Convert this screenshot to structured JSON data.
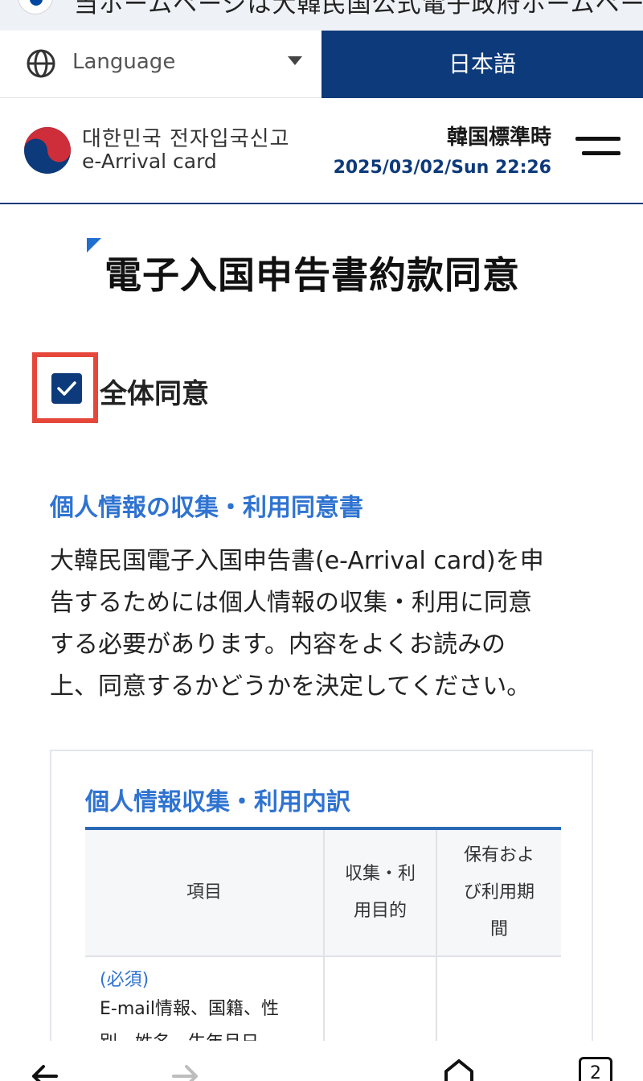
{
  "notice": {
    "text": "当ホームページは大韓民国公式電子政府ホームページです。"
  },
  "language_bar": {
    "label": "Language",
    "selected": "日本語"
  },
  "header": {
    "brand_ko": "대한민국 전자입국신고",
    "brand_en": "e-Arrival card",
    "timezone": "韓国標準時",
    "datetime": "2025/03/02/Sun 22:26"
  },
  "page": {
    "title": "電子入国申告書約款同意"
  },
  "agree_all": {
    "label": "全体同意",
    "checked": true
  },
  "section": {
    "heading": "個人情報の収集・利用同意書",
    "body_lines": [
      "大韓民国電子入国申告書(e-Arrival card)を申",
      "告するためには個人情報の収集・利用に同意",
      "する必要があります。内容をよくお読みの",
      "上、同意するかどうかを決定してください。"
    ]
  },
  "table": {
    "title": "個人情報収集・利用内訳",
    "headers": {
      "item": "項目",
      "purpose_lines": [
        "収集・利",
        "用目的"
      ],
      "period_lines": [
        "保有およ",
        "び利用期",
        "間"
      ]
    },
    "row1": {
      "required": "(必須)",
      "item_lines": [
        "E-mail情報、国籍、性",
        "別、姓名、生年月日"
      ]
    }
  },
  "navbar": {
    "tabs_count": "2"
  },
  "colors": {
    "brand_navy": "#0d3a7a",
    "accent_blue": "#2f73d1",
    "highlight_red": "#e5483b"
  }
}
